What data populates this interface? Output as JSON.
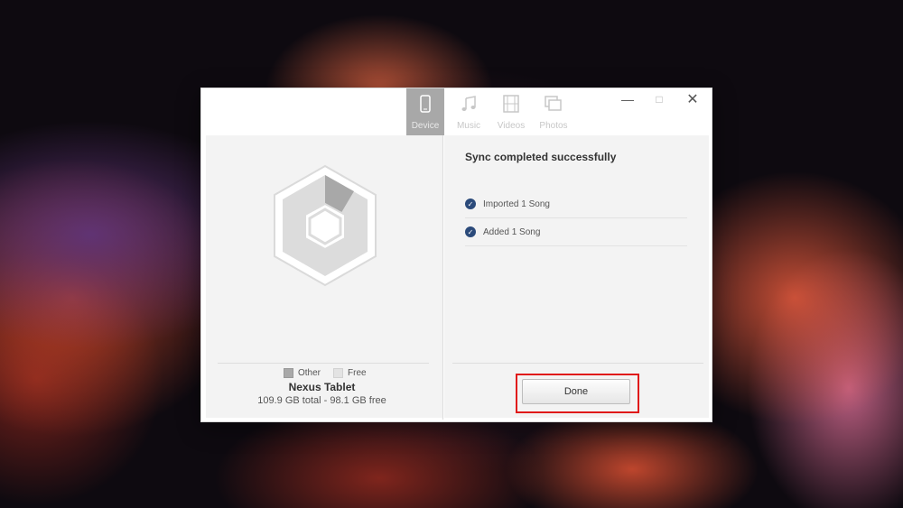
{
  "tabs": [
    {
      "label": "Device",
      "icon": "phone-icon",
      "active": true
    },
    {
      "label": "Music",
      "icon": "music-note-icon",
      "active": false
    },
    {
      "label": "Videos",
      "icon": "film-icon",
      "active": false
    },
    {
      "label": "Photos",
      "icon": "photos-icon",
      "active": false
    }
  ],
  "window_controls": {
    "minimize": "—",
    "maximize": "□",
    "close": "✕"
  },
  "legend": {
    "other": "Other",
    "free": "Free"
  },
  "device": {
    "name": "Nexus Tablet",
    "storage": "109.9 GB total - 98.1 GB free"
  },
  "sync": {
    "title": "Sync completed successfully",
    "items": [
      "Imported 1 Song",
      "Added 1 Song"
    ]
  },
  "done_label": "Done",
  "colors": {
    "accent_check": "#2b4a7a",
    "highlight": "#e01a1a",
    "tab_active": "#a8a8a8"
  }
}
